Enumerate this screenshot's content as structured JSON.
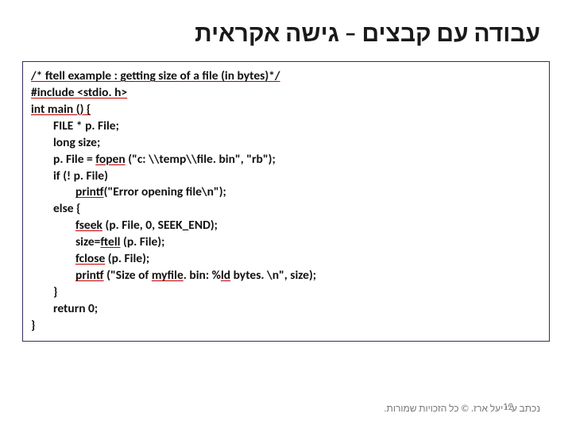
{
  "title": "עבודה עם קבצים – גישה אקראית",
  "code": {
    "l1": "/* ftell example : getting size of a file (in bytes)*/",
    "l2a": "#include <",
    "l2b": "stdio",
    "l2c": ". h>",
    "l3a": "int",
    "l3b": " main () {",
    "l4": "FILE * p. File;",
    "l5": "long size;",
    "l6a": "p. File = ",
    "l6b": "fopen",
    "l6c": " (\"c: \\\\temp\\\\file. bin\", \"rb\");",
    "l7": "if (! p. File)",
    "l8a": "printf",
    "l8b": "(\"Error opening file\\n\");",
    "l9": "else {",
    "l10a": "fseek",
    "l10b": " (p. File, 0, SEEK_END);",
    "l11a": "size=",
    "l11b": "ftell",
    "l11c": " (p. File);",
    "l12a": "fclose",
    "l12b": " (p. File);",
    "l13a": "printf",
    "l13b": " (\"Size of ",
    "l13c": "myfile",
    "l13d": ". bin: %",
    "l13e": "ld",
    "l13f": " bytes. \\n\", size);",
    "l14": "}",
    "l15": "return 0;",
    "l16": "}"
  },
  "footer": "נכתב ע\"י יעל ארז. © כל הזכויות שמורות.",
  "page": "12"
}
